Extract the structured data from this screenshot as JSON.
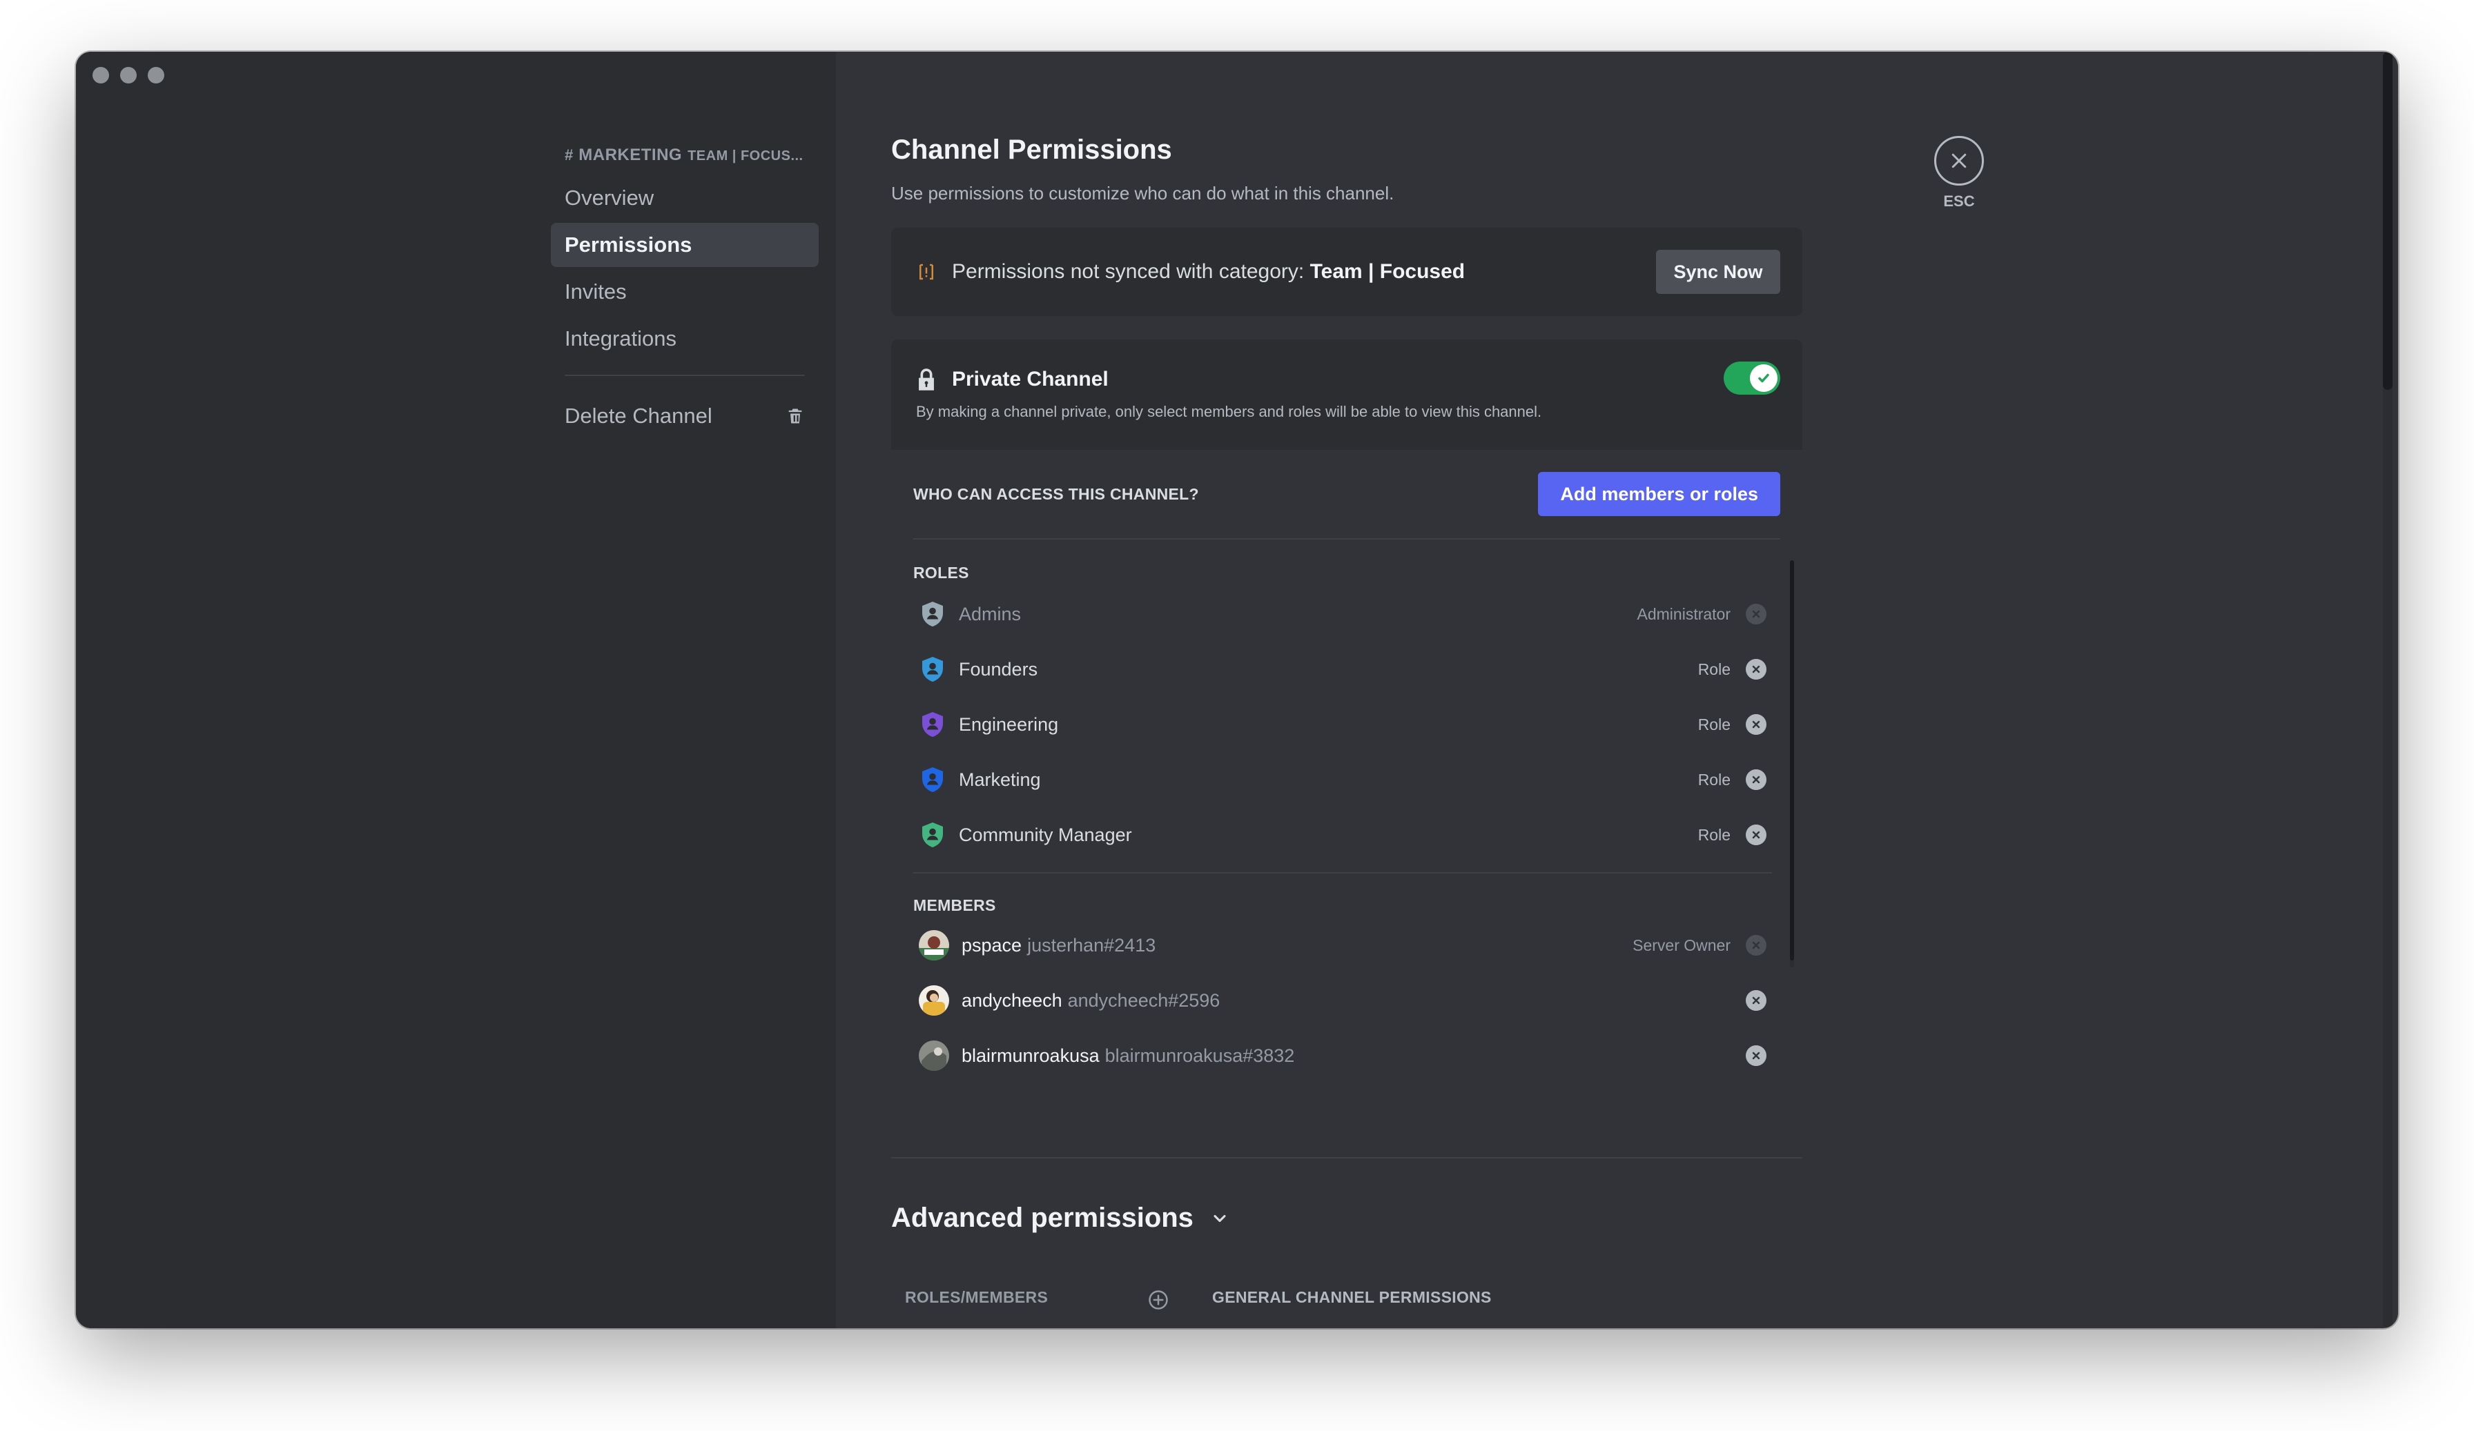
{
  "sidebar": {
    "header_hash": "#",
    "category_name": "MARKETING",
    "category_sub": "TEAM | FOCUS...",
    "items": [
      {
        "label": "Overview"
      },
      {
        "label": "Permissions"
      },
      {
        "label": "Invites"
      },
      {
        "label": "Integrations"
      }
    ],
    "delete_label": "Delete Channel"
  },
  "main": {
    "title": "Channel Permissions",
    "description": "Use permissions to customize who can do what in this channel.",
    "sync": {
      "text_prefix": "Permissions not synced with category: ",
      "category": "Team | Focused",
      "button": "Sync Now"
    },
    "private": {
      "title": "Private Channel",
      "subtitle": "By making a channel private, only select members and roles will be able to view this channel.",
      "enabled": true
    },
    "access": {
      "label": "WHO CAN ACCESS THIS CHANNEL?",
      "add_button": "Add members or roles",
      "roles_label": "ROLES",
      "roles": [
        {
          "name": "Admins",
          "type": "Administrator",
          "color": "#99aab5",
          "removable": false
        },
        {
          "name": "Founders",
          "type": "Role",
          "color": "#3498db",
          "removable": true
        },
        {
          "name": "Engineering",
          "type": "Role",
          "color": "#7b4fd6",
          "removable": true
        },
        {
          "name": "Marketing",
          "type": "Role",
          "color": "#1f66e5",
          "removable": true
        },
        {
          "name": "Community Manager",
          "type": "Role",
          "color": "#43b581",
          "removable": true
        }
      ],
      "members_label": "MEMBERS",
      "members": [
        {
          "name": "pspace",
          "tag": "justerhan#2413",
          "type": "Server Owner",
          "removable": false
        },
        {
          "name": "andycheech",
          "tag": "andycheech#2596",
          "type": "",
          "removable": true
        },
        {
          "name": "blairmunroakusa",
          "tag": "blairmunroakusa#3832",
          "type": "",
          "removable": true
        }
      ]
    },
    "advanced": {
      "title": "Advanced permissions",
      "col_roles": "ROLES/MEMBERS",
      "col_general": "GENERAL CHANNEL PERMISSIONS"
    }
  },
  "close": {
    "label": "ESC"
  },
  "colors": {
    "accent": "#5865f2",
    "toggle_on": "#23a55a",
    "background": "#313338",
    "sidebar": "#2b2d31"
  }
}
